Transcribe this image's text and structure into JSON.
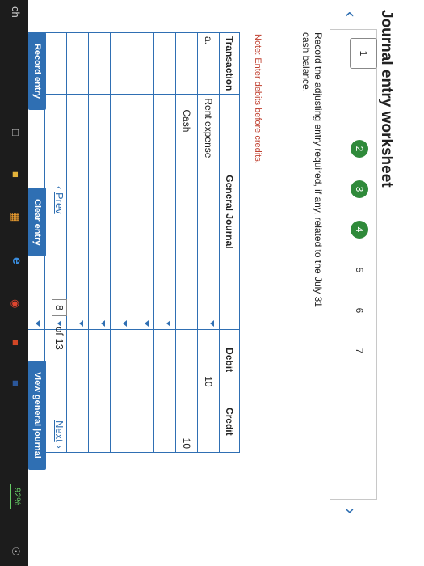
{
  "title": "Journal entry worksheet",
  "steps": [
    "1",
    "2",
    "3",
    "4",
    "5",
    "6",
    "7"
  ],
  "instruction": "Record the adjusting entry required, if any, related to the July 31 cash balance.",
  "note": "Note: Enter debits before credits.",
  "table": {
    "headers": [
      "Transaction",
      "General Journal",
      "Debit",
      "Credit"
    ],
    "rows": [
      {
        "transaction": "a.",
        "account": "Rent expense",
        "debit": "10",
        "credit": ""
      },
      {
        "transaction": "",
        "account": "Cash",
        "debit": "",
        "credit": "10"
      },
      {
        "transaction": "",
        "account": "",
        "debit": "",
        "credit": ""
      },
      {
        "transaction": "",
        "account": "",
        "debit": "",
        "credit": ""
      },
      {
        "transaction": "",
        "account": "",
        "debit": "",
        "credit": ""
      },
      {
        "transaction": "",
        "account": "",
        "debit": "",
        "credit": ""
      },
      {
        "transaction": "",
        "account": "",
        "debit": "",
        "credit": ""
      },
      {
        "transaction": "",
        "account": "",
        "debit": "",
        "credit": ""
      },
      {
        "transaction": "",
        "account": "",
        "debit": "",
        "credit": ""
      }
    ]
  },
  "buttons": {
    "record": "Record entry",
    "clear": "Clear entry",
    "view": "View general journal"
  },
  "pager": {
    "prev": "Prev",
    "current": "8",
    "of": "of 13",
    "next": "Next"
  },
  "taskbar": {
    "search": "ch",
    "battery": "92%"
  }
}
